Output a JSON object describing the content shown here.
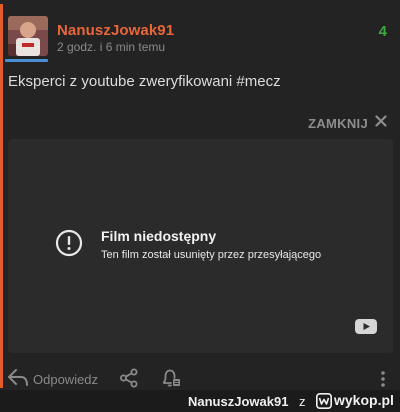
{
  "post": {
    "username": "NanuszJowak91",
    "timestamp": "2 godz. i 6 min temu",
    "votes": "4",
    "text": "Eksperci z youtube zweryfikowani #mecz"
  },
  "embed": {
    "close_label": "ZAMKNIJ",
    "video_title": "Film niedostępny",
    "video_message": "Ten film został usunięty przez przesyłającego"
  },
  "actions": {
    "reply_label": "Odpowiedz"
  },
  "watermark": {
    "user": "NanuszJowak91",
    "connector": "z",
    "brand": "wykop.pl"
  },
  "colors": {
    "username": "#e8663a",
    "votes": "#3fa83f",
    "accent": "#e25b2a",
    "avatar_underline": "#4a8fd6"
  },
  "icons": [
    "alert-circle-icon",
    "youtube-icon",
    "close-icon",
    "reply-icon",
    "share-icon",
    "notification-bell-icon",
    "more-vertical-icon",
    "wykop-logo-icon"
  ]
}
